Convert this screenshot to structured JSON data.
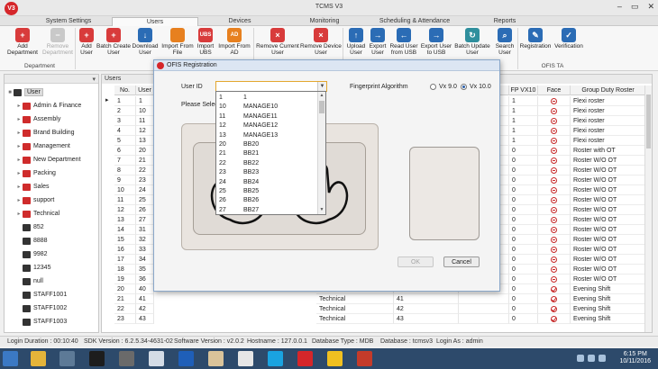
{
  "app": {
    "title": "TCMS V3",
    "logo_text": "V3"
  },
  "window_controls": {
    "minimize": "–",
    "maximize": "▭",
    "close": "✕"
  },
  "menu_tabs": [
    {
      "label": "System Settings"
    },
    {
      "label": "Users"
    },
    {
      "label": "Devices"
    },
    {
      "label": "Monitoring"
    },
    {
      "label": "Scheduling & Attendance"
    },
    {
      "label": "Reports"
    }
  ],
  "ribbon": {
    "buttons": [
      {
        "label": "Add Department",
        "icon": "add-department-icon"
      },
      {
        "label": "Remove Department",
        "icon": "remove-department-icon"
      },
      {
        "label": "Add User",
        "icon": "add-user-icon"
      },
      {
        "label": "Batch Create User",
        "icon": "batch-create-icon"
      },
      {
        "label": "Download User",
        "icon": "download-icon"
      },
      {
        "label": "Import From File",
        "icon": "folder-icon"
      },
      {
        "label": "Import UBS",
        "icon": "import-ubs-icon"
      },
      {
        "label": "Import From AD",
        "icon": "import-ad-icon"
      },
      {
        "label": "Remove Current User",
        "icon": "remove-user-icon"
      },
      {
        "label": "Remove Device User",
        "icon": "remove-device-user-icon"
      },
      {
        "label": "Upload User",
        "icon": "upload-icon"
      },
      {
        "label": "Export User",
        "icon": "export-icon"
      },
      {
        "label": "Read User from USB",
        "icon": "read-usb-icon"
      },
      {
        "label": "Export User to USB",
        "icon": "export-usb-icon"
      },
      {
        "label": "Batch Update User",
        "icon": "batch-update-icon"
      },
      {
        "label": "Search User",
        "icon": "search-user-icon"
      },
      {
        "label": "Registration",
        "icon": "registration-icon"
      },
      {
        "label": "Verification",
        "icon": "verification-icon"
      }
    ],
    "glyphs": {
      "ubs": "UBS",
      "ad": "AD"
    },
    "groups": {
      "department": "Department",
      "ofis": "OFIS TA"
    }
  },
  "tree": {
    "root": "User",
    "departments": [
      "Admin & Finance",
      "Assembly",
      "Brand Building",
      "Management",
      "New Department",
      "Packing",
      "Sales",
      "support",
      "Technical"
    ],
    "users": [
      "852",
      "8888",
      "9982",
      "12345",
      "null",
      "STAFF1001",
      "STAFF1002",
      "STAFF1003"
    ]
  },
  "grid": {
    "title": "Users",
    "columns": {
      "no": "No.",
      "user": "User",
      "dept": "",
      "fp": "FP VX10",
      "face": "Face",
      "roster": "Group Duty Roster"
    },
    "rows": [
      {
        "no": "1",
        "user": "1",
        "dept": "",
        "uid": "",
        "fp": "1",
        "face": "minus",
        "roster": "Flexi roster"
      },
      {
        "no": "2",
        "user": "10",
        "dept": "",
        "uid": "",
        "fp": "1",
        "face": "minus",
        "roster": "Flexi roster"
      },
      {
        "no": "3",
        "user": "11",
        "dept": "",
        "uid": "",
        "fp": "1",
        "face": "minus",
        "roster": "Flexi roster"
      },
      {
        "no": "4",
        "user": "12",
        "dept": "",
        "uid": "",
        "fp": "1",
        "face": "minus",
        "roster": "Flexi roster"
      },
      {
        "no": "5",
        "user": "13",
        "dept": "",
        "uid": "",
        "fp": "1",
        "face": "minus",
        "roster": "Flexi roster"
      },
      {
        "no": "6",
        "user": "20",
        "dept": "",
        "uid": "",
        "fp": "0",
        "face": "minus",
        "roster": "Roster with OT"
      },
      {
        "no": "7",
        "user": "21",
        "dept": "",
        "uid": "",
        "fp": "0",
        "face": "minus",
        "roster": "Roster W/O OT"
      },
      {
        "no": "8",
        "user": "22",
        "dept": "",
        "uid": "",
        "fp": "0",
        "face": "minus",
        "roster": "Roster W/O OT"
      },
      {
        "no": "9",
        "user": "23",
        "dept": "",
        "uid": "",
        "fp": "0",
        "face": "minus",
        "roster": "Roster W/O OT"
      },
      {
        "no": "10",
        "user": "24",
        "dept": "",
        "uid": "",
        "fp": "0",
        "face": "minus",
        "roster": "Roster W/O OT"
      },
      {
        "no": "11",
        "user": "25",
        "dept": "",
        "uid": "",
        "fp": "0",
        "face": "minus",
        "roster": "Roster W/O OT"
      },
      {
        "no": "12",
        "user": "26",
        "dept": "",
        "uid": "",
        "fp": "0",
        "face": "minus",
        "roster": "Roster W/O OT"
      },
      {
        "no": "13",
        "user": "27",
        "dept": "",
        "uid": "",
        "fp": "0",
        "face": "minus",
        "roster": "Roster W/O OT"
      },
      {
        "no": "14",
        "user": "31",
        "dept": "",
        "uid": "",
        "fp": "0",
        "face": "minus",
        "roster": "Roster W/O OT"
      },
      {
        "no": "15",
        "user": "32",
        "dept": "",
        "uid": "",
        "fp": "0",
        "face": "minus",
        "roster": "Roster W/O OT"
      },
      {
        "no": "16",
        "user": "33",
        "dept": "",
        "uid": "",
        "fp": "0",
        "face": "minus",
        "roster": "Roster W/O OT"
      },
      {
        "no": "17",
        "user": "34",
        "dept": "",
        "uid": "",
        "fp": "0",
        "face": "minus",
        "roster": "Roster W/O OT"
      },
      {
        "no": "18",
        "user": "35",
        "dept": "",
        "uid": "",
        "fp": "0",
        "face": "minus",
        "roster": "Roster W/O OT"
      },
      {
        "no": "19",
        "user": "36",
        "dept": "",
        "uid": "",
        "fp": "0",
        "face": "minus",
        "roster": "Roster W/O OT"
      },
      {
        "no": "20",
        "user": "40",
        "dept": "Technical",
        "uid": "40",
        "fp": "0",
        "face": "check",
        "roster": "Evening Shift"
      },
      {
        "no": "21",
        "user": "41",
        "dept": "Technical",
        "uid": "41",
        "fp": "0",
        "face": "check",
        "roster": "Evening Shift"
      },
      {
        "no": "22",
        "user": "42",
        "dept": "Technical",
        "uid": "42",
        "fp": "0",
        "face": "check",
        "roster": "Evening Shift"
      },
      {
        "no": "23",
        "user": "43",
        "dept": "Technical",
        "uid": "43",
        "fp": "0",
        "face": "check",
        "roster": "Evening Shift"
      }
    ]
  },
  "status_bar": {
    "login_duration": "Login Duration : 00:10:40",
    "sdk_version": "SDK Version : 6.2.5.34-4631-02",
    "software_version": "Software Version : v2.0.2",
    "hostname": "Hostname : 127.0.0.1",
    "database_type": "Database Type : MDB",
    "database": "Database : tcmsv3",
    "login_as": "Login As : admin"
  },
  "dialog": {
    "title": "OFIS Registration",
    "user_id_label": "User ID",
    "user_id_value": "",
    "dropdown_arrow": "▼",
    "please_select": "Please Select Y",
    "fp_algorithm_label": "Fingerprint Algorithm",
    "radio_v9": "Vx 9.0",
    "radio_v10": "Vx 10.0",
    "ok_label": "OK",
    "cancel_label": "Cancel",
    "options": [
      {
        "id": "1",
        "name": "1"
      },
      {
        "id": "10",
        "name": "MANAGE10"
      },
      {
        "id": "11",
        "name": "MANAGE11"
      },
      {
        "id": "12",
        "name": "MANAGE12"
      },
      {
        "id": "13",
        "name": "MANAGE13"
      },
      {
        "id": "20",
        "name": "BB20"
      },
      {
        "id": "21",
        "name": "BB21"
      },
      {
        "id": "22",
        "name": "BB22"
      },
      {
        "id": "23",
        "name": "BB23"
      },
      {
        "id": "24",
        "name": "BB24"
      },
      {
        "id": "25",
        "name": "BB25"
      },
      {
        "id": "26",
        "name": "BB26"
      },
      {
        "id": "27",
        "name": "BB27"
      }
    ]
  },
  "taskbar": {
    "time": "6:15 PM",
    "date": "10/11/2016"
  }
}
